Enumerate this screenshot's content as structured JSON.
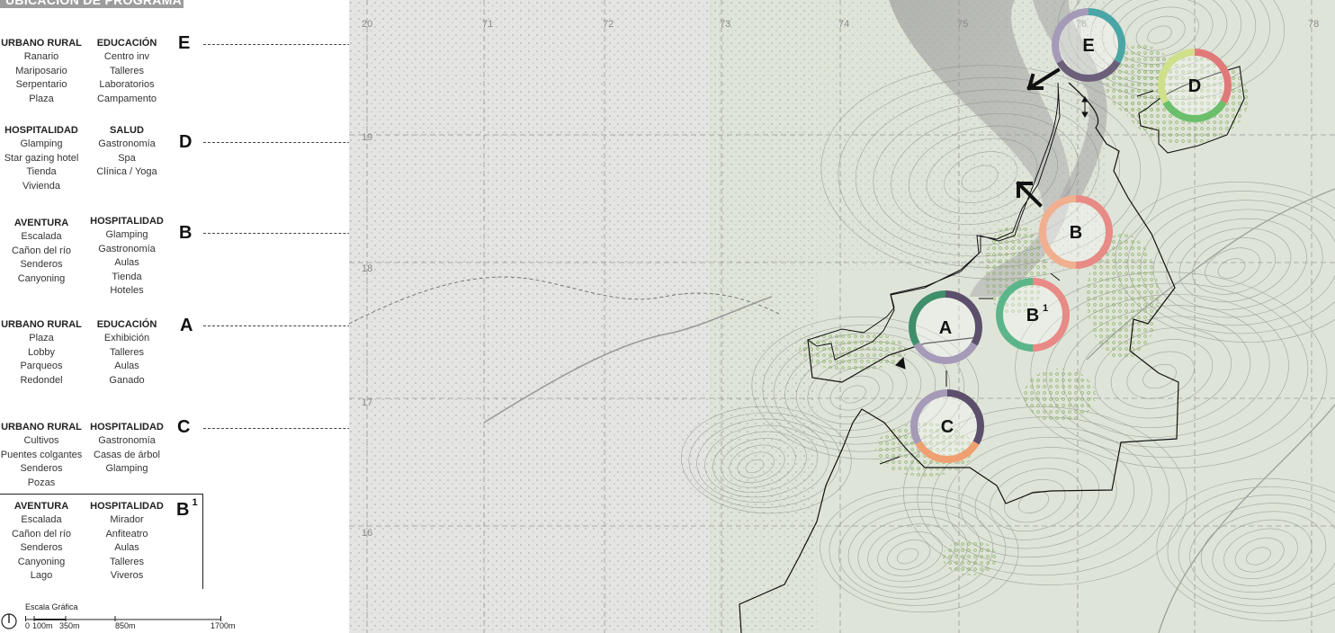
{
  "header": {
    "title": "UBICACIÓN DE PROGRAMA"
  },
  "legend": {
    "E": {
      "letter": "E",
      "left": {
        "heading": "URBANO RURAL",
        "items": [
          "Ranario",
          "Mariposario",
          "Serpentario",
          "Plaza"
        ]
      },
      "right": {
        "heading": "EDUCACIÓN",
        "items": [
          "Centro inv",
          "Talleres",
          "Laboratorios",
          "Campamento"
        ]
      }
    },
    "D": {
      "letter": "D",
      "left": {
        "heading": "HOSPITALIDAD",
        "items": [
          "Glamping",
          "Star gazing hotel",
          "Tienda",
          "Vivienda"
        ]
      },
      "right": {
        "heading": "SALUD",
        "items": [
          "Gastronomía",
          "Spa",
          "Clínica / Yoga"
        ]
      }
    },
    "B": {
      "letter": "B",
      "left": {
        "heading": "AVENTURA",
        "items": [
          "Escalada",
          "Cañon del río",
          "Senderos",
          "Canyoning"
        ]
      },
      "right": {
        "heading": "HOSPITALIDAD",
        "items": [
          "Glamping",
          "Gastronomía",
          "Aulas",
          "Tienda",
          "Hoteles"
        ]
      }
    },
    "A": {
      "letter": "A",
      "left": {
        "heading": "URBANO RURAL",
        "items": [
          "Plaza",
          "Lobby",
          "Parqueos",
          "Redondel"
        ]
      },
      "right": {
        "heading": "EDUCACIÓN",
        "items": [
          "Exhibición",
          "Talleres",
          "Aulas",
          "Ganado"
        ]
      }
    },
    "C": {
      "letter": "C",
      "left": {
        "heading": "URBANO RURAL",
        "items": [
          "Cultivos",
          "Puentes colgantes",
          "Senderos",
          "Pozas"
        ]
      },
      "right": {
        "heading": "HOSPITALIDAD",
        "items": [
          "Gastronomía",
          "Casas de árbol",
          "Glamping"
        ]
      }
    },
    "B1": {
      "letter": "B",
      "sup": "1",
      "left": {
        "heading": "AVENTURA",
        "items": [
          "Escalada",
          "Cañon del río",
          "Senderos",
          "Canyoning",
          "Lago"
        ]
      },
      "right": {
        "heading": "HOSPITALIDAD",
        "items": [
          "Mirador",
          "Anfiteatro",
          "Aulas",
          "Talleres",
          "Viveros"
        ]
      }
    }
  },
  "map": {
    "grid_x_labels": [
      "20",
      "71",
      "72",
      "73",
      "74",
      "75",
      "76",
      "78"
    ],
    "grid_y_labels": [
      "19",
      "18",
      "17",
      "16"
    ],
    "zones": [
      {
        "label": "E",
        "sup": "",
        "colors": [
          "#4aa6a6",
          "#6b5f7a",
          "#a59ab8"
        ]
      },
      {
        "label": "D",
        "sup": "",
        "colors": [
          "#e07a7a",
          "#6bbf6b",
          "#cfe08a"
        ]
      },
      {
        "label": "B",
        "sup": "",
        "colors": [
          "#e88a86",
          "#f0b090"
        ]
      },
      {
        "label": "B",
        "sup": "1",
        "colors": [
          "#e88a86",
          "#5bb58a"
        ]
      },
      {
        "label": "A",
        "sup": "",
        "colors": [
          "#5c4f6b",
          "#a59ab8",
          "#3f8f6a"
        ]
      },
      {
        "label": "C",
        "sup": "",
        "colors": [
          "#5c4f6b",
          "#f0a070",
          "#a59ab8"
        ]
      }
    ]
  },
  "scale": {
    "title": "Escala Gráfica",
    "labels": [
      "0",
      "100m",
      "350m",
      "850m",
      "1700m"
    ]
  },
  "colors": {
    "guide_line": "#444444",
    "map_light": "#e6e8e3",
    "map_green": "#dfe7d8",
    "contour": "#8a8f86",
    "boundary": "#111111"
  }
}
